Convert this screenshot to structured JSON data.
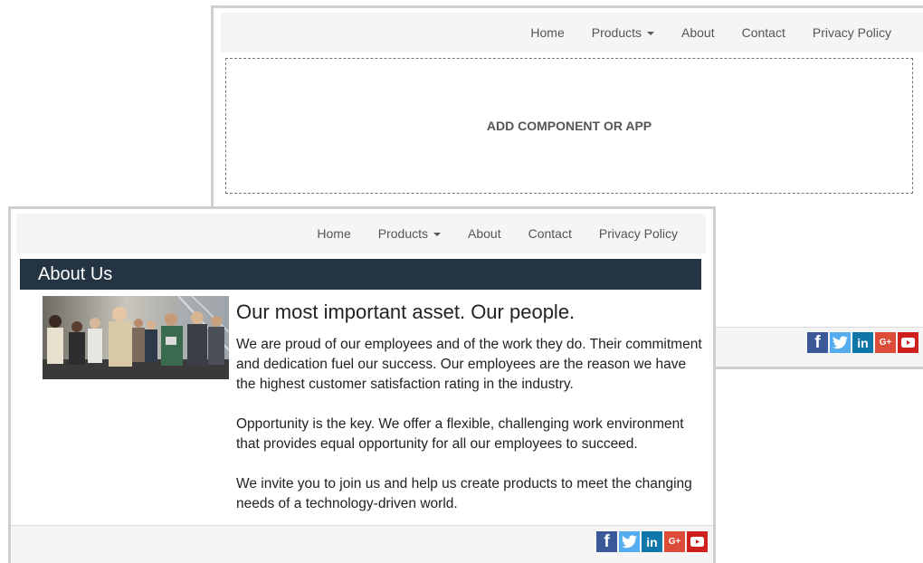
{
  "back": {
    "nav": {
      "home": "Home",
      "products": "Products",
      "about": "About",
      "contact": "Contact",
      "privacy": "Privacy Policy"
    },
    "placeholder": "ADD COMPONENT OR APP"
  },
  "front": {
    "nav": {
      "home": "Home",
      "products": "Products",
      "about": "About",
      "contact": "Contact",
      "privacy": "Privacy Policy"
    },
    "section_title": "About Us",
    "headline": "Our most important asset. Our people.",
    "paragraphs": [
      "We are proud of our employees and of the work they do. Their commitment and dedication fuel our success. Our employees are the reason we have the highest customer satisfaction rating in the industry.",
      "Opportunity is the key. We offer a flexible, challenging work environment that provides equal opportunity for all our employees to succeed.",
      "We invite you to join us and help us create products to meet the changing needs of a technology-driven world."
    ]
  },
  "social_icons": [
    "facebook-icon",
    "twitter-icon",
    "linkedin-icon",
    "google-plus-icon",
    "youtube-icon"
  ],
  "social": {
    "facebook": "f",
    "linkedin": "in",
    "google_plus": "G+"
  },
  "colors": {
    "header_bar": "#243442",
    "nav_bg": "#f5f5f5",
    "facebook": "#3b5998",
    "twitter": "#55acee",
    "linkedin": "#0e76a8",
    "google_plus": "#dd4b39",
    "youtube": "#cd201f"
  }
}
